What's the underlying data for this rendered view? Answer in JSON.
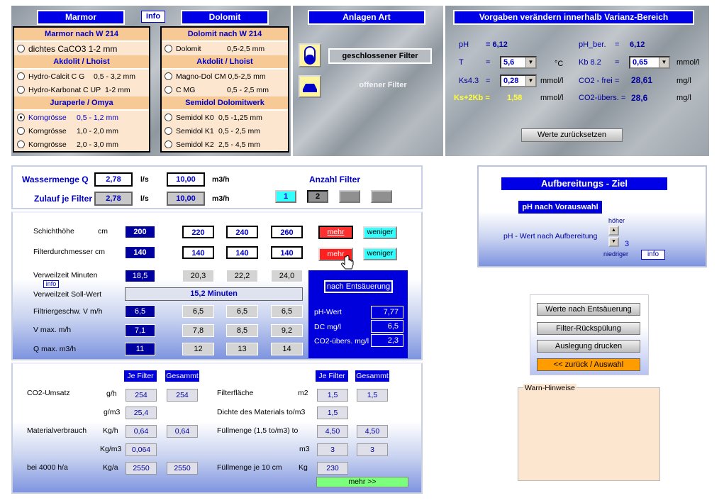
{
  "top": {
    "marmor_tab": "Marmor",
    "info_tab": "info",
    "dolomit_tab": "Dolomit",
    "marmor_list": {
      "h1": "Marmor  nach W 214",
      "o1": "dichtes CaCO3 1-2 mm",
      "h2": "Akdolit / Lhoist",
      "o2a": "Hydro-Calcit C G",
      "o2b": "0,5 - 3,2 mm",
      "o3a": "Hydro-Karbonat C UP",
      "o3b": "1-2 mm",
      "h3": "Juraperle / Omya",
      "o4a": "Korngrösse",
      "o4b": "0,5 - 1,2 mm",
      "o5a": "Korngrösse",
      "o5b": "1,0 - 2,0 mm",
      "o6a": "Korngrösse",
      "o6b": "2,0 - 3,0 mm"
    },
    "dolomit_list": {
      "h1": "Dolomit  nach W 214",
      "o1a": "Dolomit",
      "o1b": "0,5-2,5 mm",
      "h2": "Akdolit / Lhoist",
      "o2a": "Magno-Dol  CM 0,5-2,5 mm",
      "o3a": "C MG",
      "o3b": "0,5 - 2,5 mm",
      "h3": "Semidol  Dolomitwerk",
      "o4a": "Semidol  K0",
      "o4b": "0,5 -1,25 mm",
      "o5a": "Semidol  K1",
      "o5b": "0,5 - 2,5 mm",
      "o6a": "Semidol  K2",
      "o6b": "2,5 - 4,5 mm"
    },
    "anlagen_title": "Anlagen Art",
    "closed_filter": "geschlossener Filter",
    "open_filter": "offener Filter",
    "vorgaben_title": "Vorgaben verändern innerhalb Varianz-Bereich",
    "ph_label": "pH",
    "ph_value": "= 6,12",
    "ph_ber_label": "pH_ber.",
    "ph_ber_eq": "=",
    "ph_ber_value": "6,12",
    "t_label": "T",
    "t_eq": "=",
    "t_value": "5,6",
    "t_unit": "°C",
    "kb_label": "Kb 8.2",
    "kb_eq": "=",
    "kb_value": "0,65",
    "kb_unit": "mmol/l",
    "ks_label": "Ks4.3",
    "ks_eq": "=",
    "ks_value": "0,28",
    "ks_unit": "mmol/l",
    "co2frei_label": "CO2 - frei",
    "co2frei_eq": "=",
    "co2frei_value": "28,61",
    "co2frei_unit": "mg/l",
    "kskb_label": "Ks+2Kb =",
    "kskb_value": "1,58",
    "kskb_unit": "mmol/l",
    "co2ub_label": "CO2-übers. =",
    "co2ub_value": "28,6",
    "co2ub_unit": "mg/l",
    "reset_button": "Werte  zurücksetzen"
  },
  "flow": {
    "wassermenge_label": "Wassermenge Q",
    "wassermenge_ls": "2,78",
    "ls_unit": "l/s",
    "wassermenge_m3h": "10,00",
    "m3h_unit": "m3/h",
    "zulauf_label": "Zulauf je Filter",
    "zulauf_ls": "2,78",
    "zulauf_m3h": "10,00",
    "anzahl_label": "Anzahl Filter",
    "f1": "1",
    "f2": "2"
  },
  "mid": {
    "schichthoehe": "Schichthöhe",
    "cm": "cm",
    "sh": [
      "200",
      "220",
      "240",
      "260"
    ],
    "mehr": "mehr",
    "weniger": "weniger",
    "durchmesser": "Filterdurchmesser  cm",
    "fd": [
      "140",
      "140",
      "140",
      "140"
    ],
    "verweil": "Verweilzeit   Minuten",
    "vz": [
      "18,5",
      "20,3",
      "22,2",
      "24,0"
    ],
    "info": "info",
    "soll": "Verweilzeit  Soll-Wert",
    "soll_value": "15,2 Minuten",
    "fgeschw": "Filtriergeschw. V  m/h",
    "fg": [
      "6,5",
      "6,5",
      "6,5",
      "6,5"
    ],
    "vmax": "V max.  m/h",
    "vm": [
      "7,1",
      "7,8",
      "8,5",
      "9,2"
    ],
    "qmax": "Q max.  m3/h",
    "qm": [
      "11",
      "12",
      "13",
      "14"
    ],
    "entsaeuerung_btn": "nach Entsäuerung",
    "phwert": "pH-Wert",
    "phwert_v": "7,77",
    "dc": "DC  mg/l",
    "dc_v": "6,5",
    "co2": "CO2-übers. mg/l",
    "co2_v": "2,3"
  },
  "bottom": {
    "je_filter": "Je Filter",
    "gesammt": "Gesammt",
    "co2umsatz": "CO2-Umsatz",
    "gh": "g/h",
    "gh1": "254",
    "gh2": "254",
    "gm3": "g/m3",
    "gm3v": "25,4",
    "material": "Materialverbrauch",
    "kgh": "Kg/h",
    "kgh1": "0,64",
    "kgh2": "0,64",
    "kgm3": "Kg/m3",
    "kgm3v": "0,064",
    "bei": "bei 4000 h/a",
    "kga": "Kg/a",
    "kga1": "2550",
    "kga2": "2550",
    "filterflaeche": "Filterfläche",
    "m2": "m2",
    "ff1": "1,5",
    "ff2": "1,5",
    "dichte": "Dichte des Materials to/m3",
    "dichte_v": "1,5",
    "fuell": "Füllmenge  (1,5 to/m3)  to",
    "fu1": "4,50",
    "fu2": "4,50",
    "m3": "m3",
    "m31": "3",
    "m32": "3",
    "fuell10": "Füllmenge je 10 cm",
    "kg": "Kg",
    "f10": "230",
    "mehr_btn": "mehr >>"
  },
  "ziel": {
    "title": "Aufbereitungs - Ziel",
    "sub": "pH  nach  Vorauswahl",
    "hoeher": "höher",
    "niedriger": "niedriger",
    "label": "pH - Wert nach Aufbereitung",
    "value": "3",
    "info": "info"
  },
  "actions": {
    "b1": "Werte nach Entsäuerung",
    "b2": "Filter-Rückspülung",
    "b3": "Auslegung drucken",
    "b4": "<< zurück / Auswahl"
  },
  "warn_title": "Warn-Hinweise"
}
